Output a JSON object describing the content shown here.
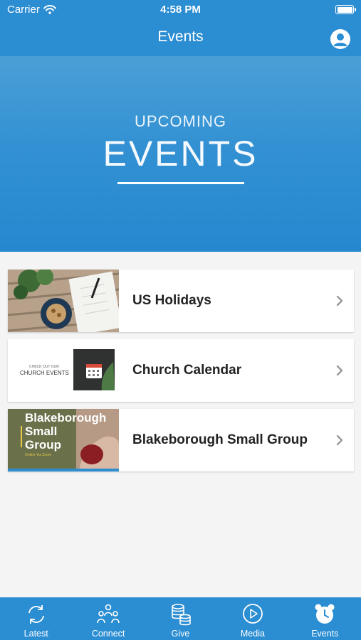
{
  "status_bar": {
    "carrier": "Carrier",
    "time": "4:58 PM"
  },
  "header": {
    "title": "Events"
  },
  "hero": {
    "kicker": "UPCOMING",
    "title": "EVENTS"
  },
  "events": [
    {
      "label": "US Holidays"
    },
    {
      "label": "Church Calendar",
      "thumb_line1": "CHECK OUT OUR",
      "thumb_line2": "CHURCH EVENTS"
    },
    {
      "label": "Blakeborough Small Group",
      "thumb_line1": "Blakeborough",
      "thumb_line2": "Small",
      "thumb_line3": "Group",
      "thumb_line4": "Online Via Zoom"
    }
  ],
  "tabs": [
    {
      "label": "Latest",
      "icon": "refresh-icon"
    },
    {
      "label": "Connect",
      "icon": "people-icon"
    },
    {
      "label": "Give",
      "icon": "coins-icon"
    },
    {
      "label": "Media",
      "icon": "play-icon"
    },
    {
      "label": "Events",
      "icon": "alarm-clock-icon"
    }
  ],
  "colors": {
    "brand": "#2b8dd2",
    "background": "#f4f4f4",
    "card": "#ffffff"
  }
}
